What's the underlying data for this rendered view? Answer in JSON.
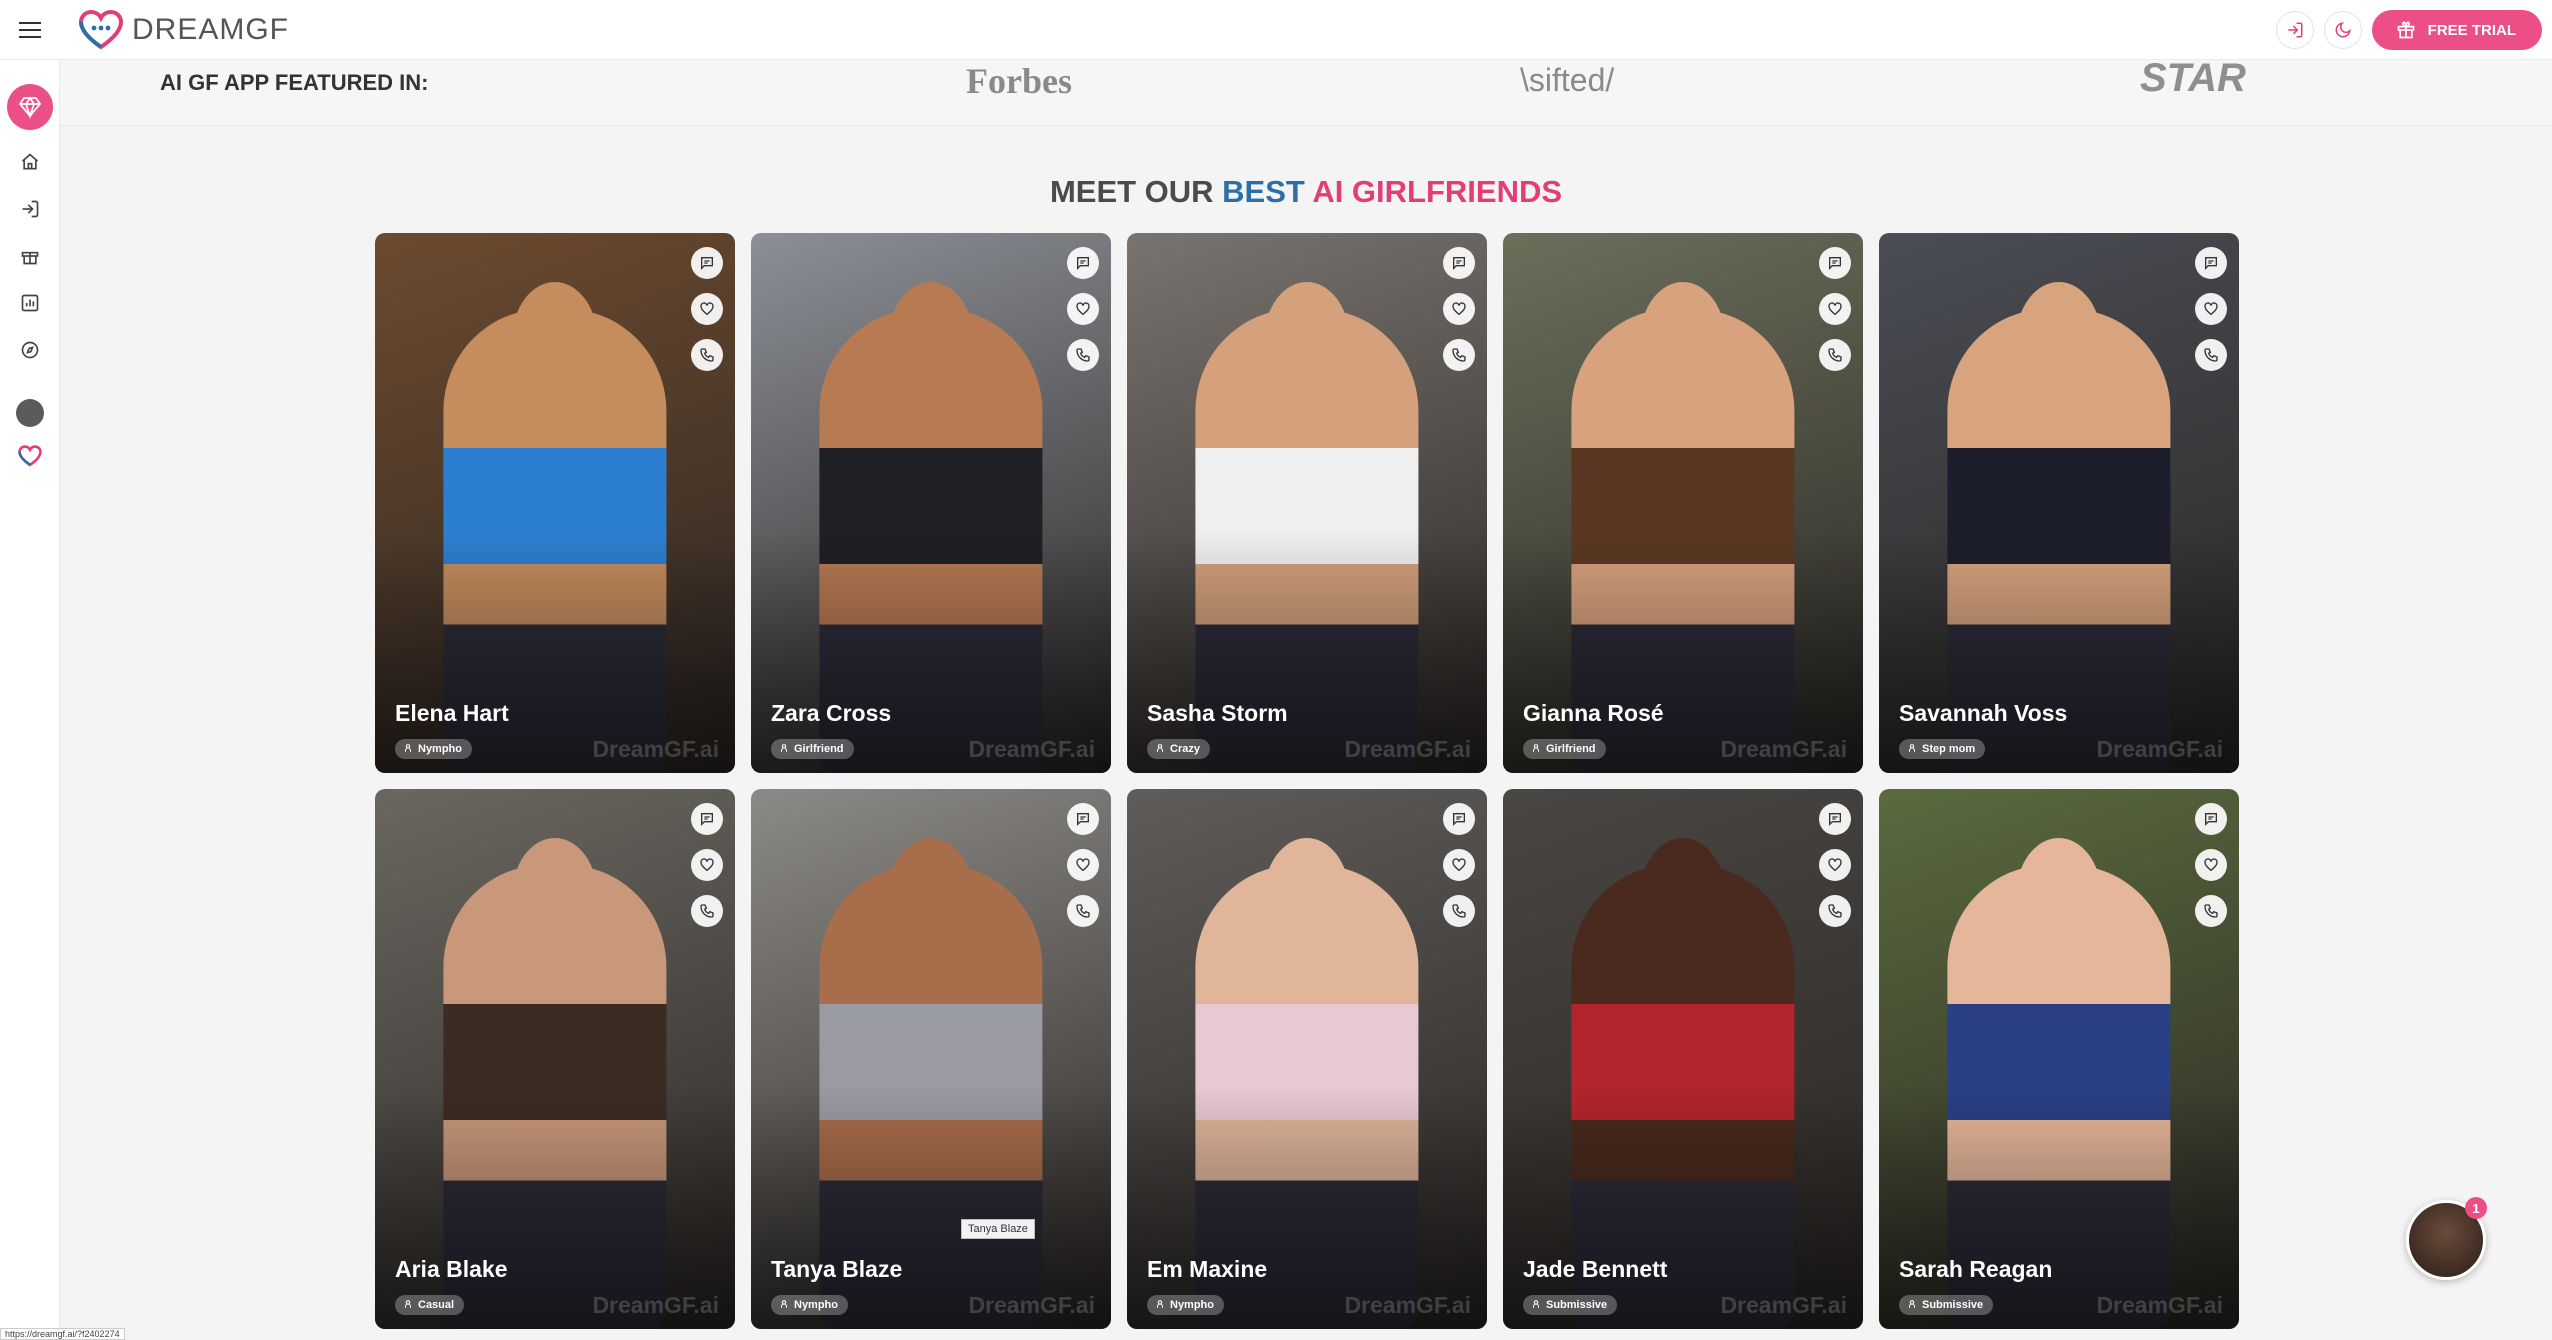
{
  "header": {
    "brand": "DREAMGF",
    "free_trial_label": "FREE TRIAL"
  },
  "featured": {
    "label": "AI GF APP FEATURED IN:",
    "brands": [
      "Forbes",
      "\\sifted/",
      "STAR"
    ]
  },
  "heading": {
    "part1": "MEET OUR ",
    "part2": "BEST ",
    "part3": "AI GIRLFRIENDS"
  },
  "colors": {
    "accent": "#ec4f86",
    "heading_blue": "#2d6ea8",
    "heading_pink": "#e33d78"
  },
  "cards": [
    {
      "name": "Elena Hart",
      "tag": "Nympho",
      "bg": "#6d4a2e",
      "skin": "#c58c5e",
      "top": "#2c7fd0"
    },
    {
      "name": "Zara Cross",
      "tag": "Girlfriend",
      "bg": "#8b8f96",
      "skin": "#b77a52",
      "top": "#1f1f26"
    },
    {
      "name": "Sasha Storm",
      "tag": "Crazy",
      "bg": "#7a7470",
      "skin": "#d4a17c",
      "top": "#efefef"
    },
    {
      "name": "Gianna Rosé",
      "tag": "Girlfriend",
      "bg": "#6b6f5a",
      "skin": "#d8a27e",
      "top": "#5a3722"
    },
    {
      "name": "Savannah Voss",
      "tag": "Step mom",
      "bg": "#4a4d55",
      "skin": "#d7a47e",
      "top": "#1c1f2b"
    },
    {
      "name": "Aria Blake",
      "tag": "Casual",
      "bg": "#6b6760",
      "skin": "#c9987a",
      "top": "#3b2b22"
    },
    {
      "name": "Tanya Blaze",
      "tag": "Nympho",
      "bg": "#8c8a86",
      "skin": "#a86d4a",
      "top": "#9a9aa3"
    },
    {
      "name": "Em Maxine",
      "tag": "Nympho",
      "bg": "#5f5c5a",
      "skin": "#e0b59a",
      "top": "#e8c8d2"
    },
    {
      "name": "Jade Bennett",
      "tag": "Submissive",
      "bg": "#4a4643",
      "skin": "#4a2a1e",
      "top": "#b3242c"
    },
    {
      "name": "Sarah Reagan",
      "tag": "Submissive",
      "bg": "#5a6b3e",
      "skin": "#e6b69a",
      "top": "#2b3f86"
    }
  ],
  "watermark": "DreamGF.ai",
  "tooltip": "Tanya Blaze",
  "chat_badge": "1",
  "status_url": "https://dreamgf.ai/?f2402274"
}
